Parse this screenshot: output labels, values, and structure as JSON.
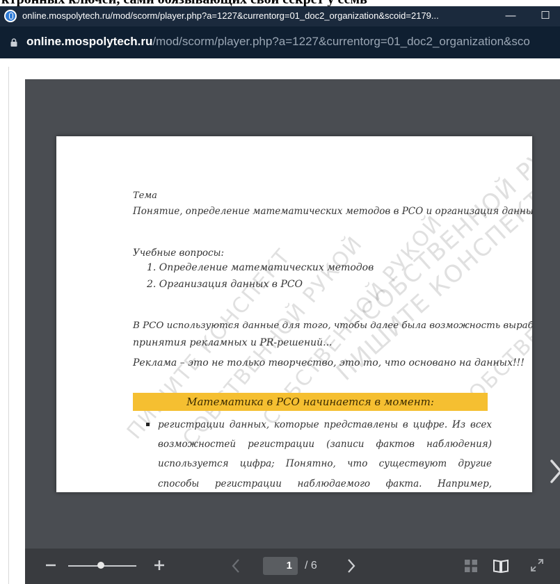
{
  "top_sliver_text": "ктронных ключей, сами обязывающих свой секрет у семь",
  "window": {
    "title": "online.mospolytech.ru/mod/scorm/player.php?a=1227&currentorg=01_doc2_organization&scoid=2179...",
    "minimize_label": "—",
    "maximize_label": "☐"
  },
  "address_bar": {
    "host": "online.mospolytech.ru",
    "path": "/mod/scorm/player.php?a=1227&currentorg=01_doc2_organization&sco"
  },
  "document": {
    "topic_label": "Тема",
    "topic_title": "Понятие, определение математических методов в РСО и организация данных",
    "questions_label": "Учебные вопросы:",
    "questions": [
      "1.  Определение математических методов",
      "2.  Организация данных в РСО"
    ],
    "paragraph_lines": [
      "В РСО используются данные для того, чтобы далее была возможность выработки и",
      "принятия рекламных и PR-решений...",
      "Реклама – это не только творчество, это то, что основано на данных!!!"
    ],
    "banner": "Математика в РСО начинается в момент:",
    "bullet_text": "регистрации данных, которые представлены в цифре. Из всех возможностей регистрации (записи фактов наблюдения) используется цифра; Понятно, что существуют другие способы регистрации наблюдаемого факта. Например, художник и его рисунок, фотограф и его фотоаппарат…. Цифра – это самый простой и быстрый способ регистрации (записи) факта, который наблюдается,",
    "watermarks": [
      "ПИШИТЕ КОНСПЕКТ",
      "СОБСТВЕННОЙ РУКОЙ",
      "СОБСТВЕННОЙ РУКОЙ",
      "ПИШИТЕ КОНСПЕКТ",
      "СОБСТВЕННОЙ РУКОЙ",
      "СОБСТВЕННОЙ РУКОЙ"
    ]
  },
  "toolbar": {
    "current_page": "1",
    "total_pages": "/ 6"
  },
  "colors": {
    "titlebar": "#1b2a3d",
    "addressbar": "#0f1f31",
    "viewer_bg": "#4a4d52",
    "toolbar_bg": "#393b3f",
    "banner": "#f5bf31"
  },
  "icons": [
    "app-favicon-icon",
    "lock-icon",
    "next-page-arrow-icon",
    "zoom-out-icon",
    "zoom-in-icon",
    "prev-page-icon",
    "next-page-icon",
    "grid-view-icon",
    "book-view-icon",
    "fullscreen-icon"
  ]
}
